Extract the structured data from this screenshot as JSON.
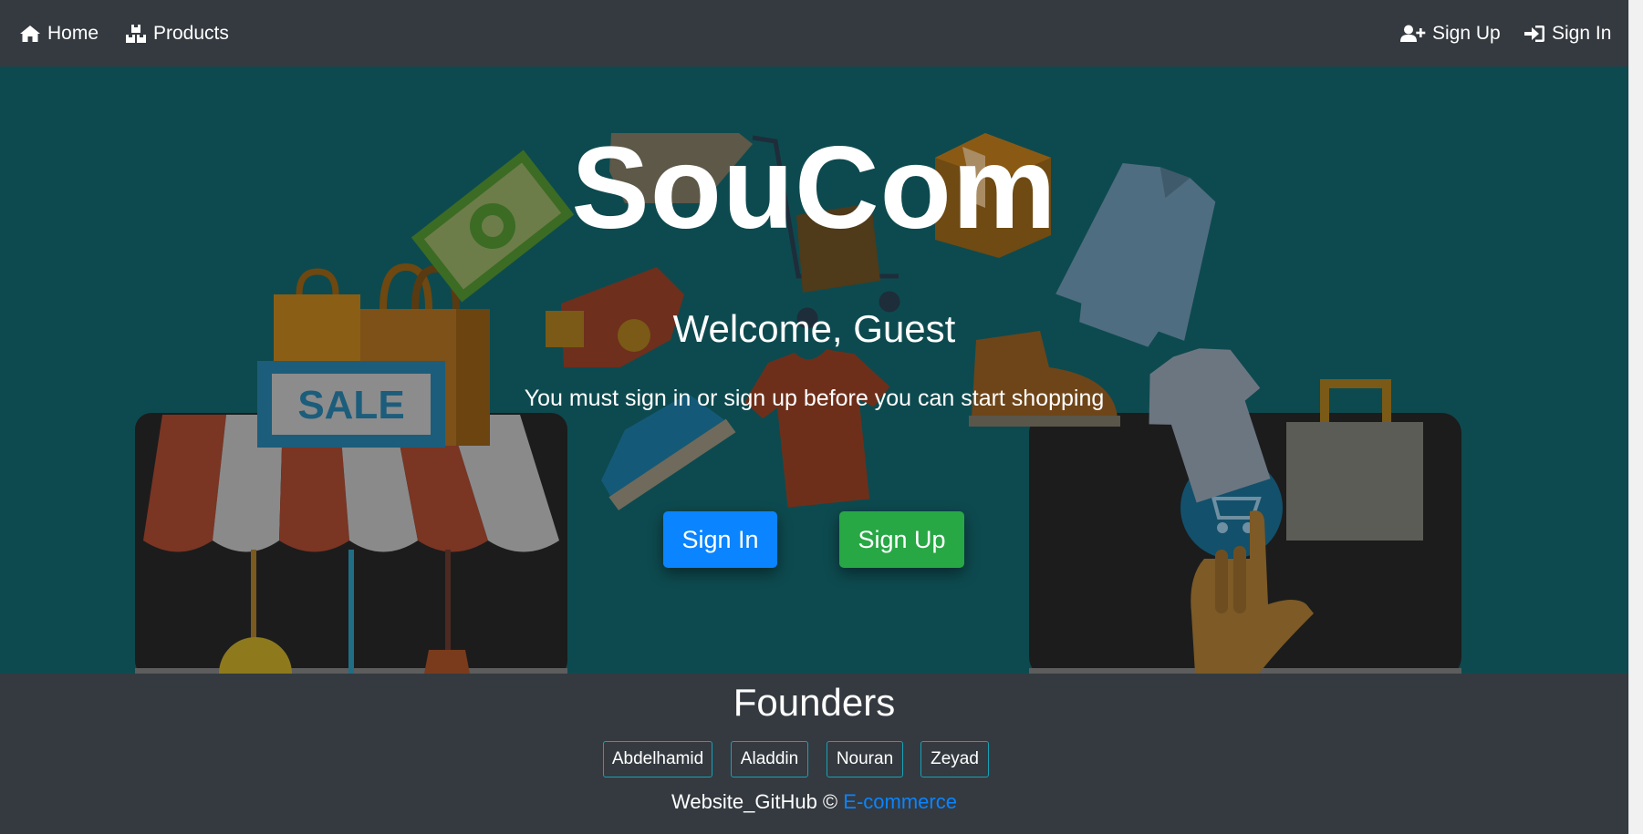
{
  "navbar": {
    "home_label": "Home",
    "products_label": "Products",
    "signup_label": "Sign Up",
    "signin_label": "Sign In"
  },
  "hero": {
    "title": "SouCom",
    "welcome": "Welcome, Guest",
    "message": "You must sign in or sign up before you can start shopping",
    "signin_button": "Sign In",
    "signup_button": "Sign Up",
    "sale_sign": "SALE"
  },
  "footer": {
    "title": "Founders",
    "founders": [
      "Abdelhamid",
      "Aladdin",
      "Nouran",
      "Zeyad"
    ],
    "credit_text": "Website_GitHub ©",
    "credit_link": "E-commerce"
  },
  "colors": {
    "navbar_bg": "#343a40",
    "hero_bg": "#0d4a4f",
    "primary": "#0a84ff",
    "success": "#28a745",
    "founder_border": "#17a2b8"
  },
  "icons": [
    "home-icon",
    "boxes-icon",
    "user-plus-icon",
    "sign-in-icon",
    "shopping-cart-icon"
  ]
}
